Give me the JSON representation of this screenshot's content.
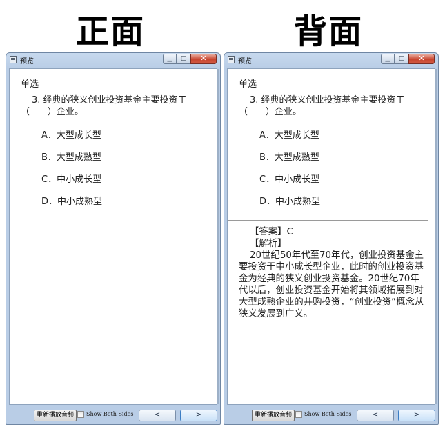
{
  "headers": {
    "front": "正面",
    "back": "背面"
  },
  "window": {
    "title": "预览",
    "minimize_glyph": "▁",
    "maximize_glyph": "□",
    "close_glyph": "✕"
  },
  "question": {
    "type": "单选",
    "stem": "3. 经典的狭义创业投资基金主要投资于（　　）企业。",
    "options": [
      {
        "letter": "A．",
        "text": "大型成长型"
      },
      {
        "letter": "B．",
        "text": "大型成熟型"
      },
      {
        "letter": "C．",
        "text": "中小成长型"
      },
      {
        "letter": "D．",
        "text": "中小成熟型"
      }
    ]
  },
  "answer": {
    "answer_label": "【答案】C",
    "analysis_label": "【解析】",
    "explanation": "20世纪50年代至70年代，创业投资基金主要投资于中小成长型企业，此时的创业投资基金为经典的狭义创业投资基金。20世纪70年代以后，创业投资基金开始将其领域拓展到对大型成熟企业的并购投资，“创业投资”概念从狭义发展到广义。"
  },
  "bottombar": {
    "replay_label": "重新播放音频",
    "show_both_label": "Show Both Sides",
    "prev_glyph": "<",
    "next_glyph": ">"
  }
}
